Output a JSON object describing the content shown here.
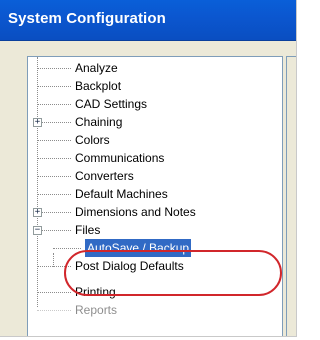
{
  "window": {
    "title": "System Configuration"
  },
  "tree": {
    "items": [
      {
        "label": "Analyze",
        "expander": ""
      },
      {
        "label": "Backplot",
        "expander": ""
      },
      {
        "label": "CAD Settings",
        "expander": ""
      },
      {
        "label": "Chaining",
        "expander": "+"
      },
      {
        "label": "Colors",
        "expander": ""
      },
      {
        "label": "Communications",
        "expander": ""
      },
      {
        "label": "Converters",
        "expander": ""
      },
      {
        "label": "Default Machines",
        "expander": ""
      },
      {
        "label": "Dimensions and Notes",
        "expander": "+"
      },
      {
        "label": "Files",
        "expander": "−"
      },
      {
        "label": "AutoSave / Backup",
        "expander": "",
        "selected": true
      },
      {
        "label": "Post Dialog Defaults",
        "expander": ""
      },
      {
        "label": "Printing",
        "expander": ""
      },
      {
        "label": "Reports",
        "expander": ""
      }
    ]
  },
  "colors": {
    "title_bar": "#0b57d0",
    "selection": "#316ac5",
    "annotation": "#d1262b"
  }
}
